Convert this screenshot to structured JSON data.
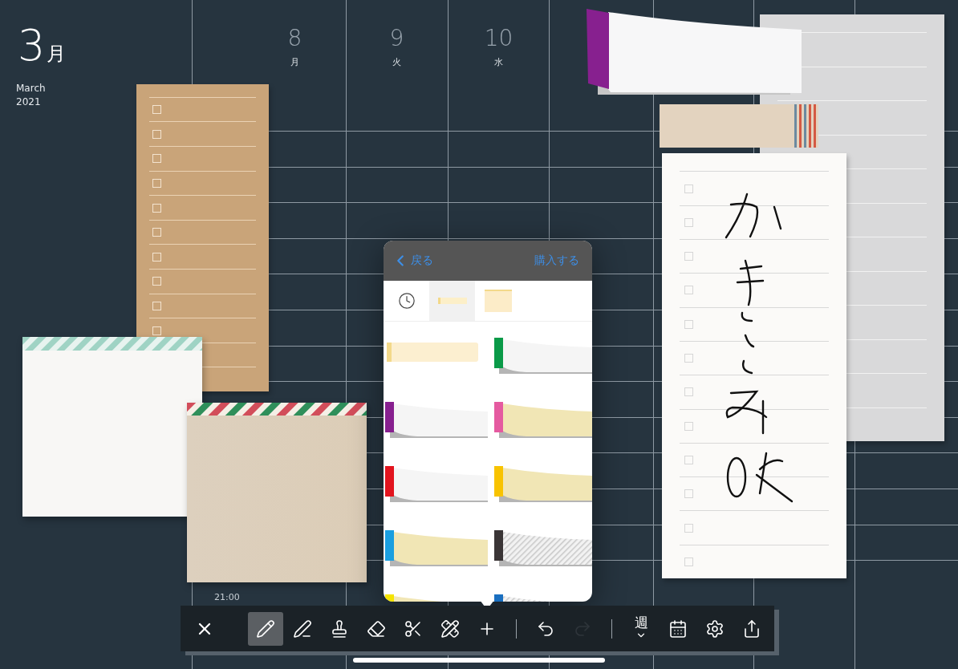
{
  "calendar": {
    "month": "3",
    "month_unit": "月",
    "month_name": "March",
    "year": "2021",
    "time_label": "21:00",
    "days": [
      {
        "date": "8",
        "weekday": "月"
      },
      {
        "date": "9",
        "weekday": "火"
      },
      {
        "date": "10",
        "weekday": "水"
      }
    ]
  },
  "popover": {
    "back_label": "戻る",
    "buy_label": "購入する",
    "tabs": [
      {
        "kind": "recent",
        "selected": false
      },
      {
        "kind": "tape",
        "selected": true
      },
      {
        "kind": "note",
        "selected": false
      }
    ],
    "tapes": [
      {
        "kind": "plain",
        "color": "#f3d98a"
      },
      {
        "kind": "white",
        "color": "#0a9a48"
      },
      {
        "kind": "white",
        "color": "#87208f"
      },
      {
        "kind": "cream",
        "color": "#e55aa0"
      },
      {
        "kind": "white",
        "color": "#e2141e"
      },
      {
        "kind": "cream",
        "color": "#f8c300"
      },
      {
        "kind": "cream",
        "color": "#1a9fe0"
      },
      {
        "kind": "striped",
        "color": "#3a3536"
      },
      {
        "kind": "cream",
        "color": "#f5e400"
      },
      {
        "kind": "striped",
        "color": "#1a6fc0"
      }
    ]
  },
  "toolbar": {
    "close": {
      "kind": "close"
    },
    "tools": [
      {
        "kind": "pencil",
        "selected": true
      },
      {
        "kind": "pen",
        "selected": false
      },
      {
        "kind": "stamp",
        "selected": false
      },
      {
        "kind": "eraser",
        "selected": false
      },
      {
        "kind": "scissors",
        "selected": false
      },
      {
        "kind": "ruler",
        "selected": false
      },
      {
        "kind": "add",
        "selected": false
      }
    ],
    "history": [
      {
        "kind": "undo",
        "disabled": false
      },
      {
        "kind": "redo",
        "disabled": true
      }
    ],
    "view_label": "週",
    "actions": [
      {
        "kind": "calendar"
      },
      {
        "kind": "settings"
      },
      {
        "kind": "share"
      }
    ]
  }
}
